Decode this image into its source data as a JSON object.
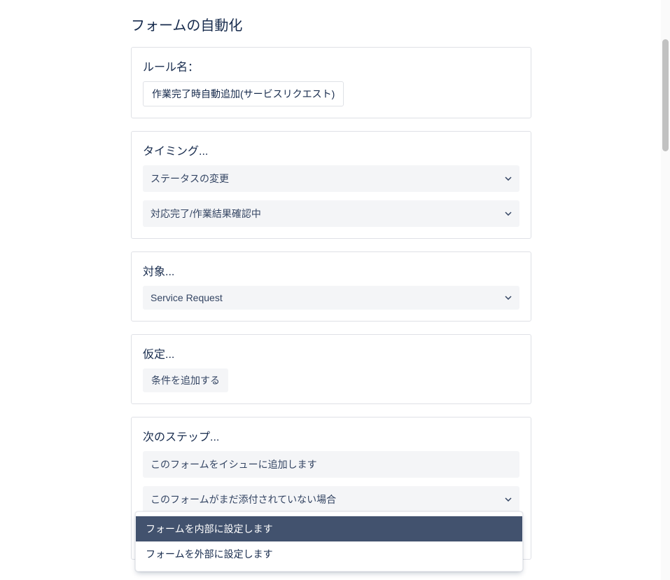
{
  "page": {
    "title": "フォームの自動化"
  },
  "ruleName": {
    "label": "ルール名：",
    "value": "作業完了時自動追加(サービスリクエスト)"
  },
  "timing": {
    "label": "タイミング...",
    "triggerType": "ステータスの変更",
    "statusValue": "対応完了/作業結果確認中"
  },
  "target": {
    "label": "対象...",
    "value": "Service Request"
  },
  "assumption": {
    "label": "仮定...",
    "addConditionLabel": "条件を追加する"
  },
  "nextStep": {
    "label": "次のステップ...",
    "actionLabel": "このフォームをイシューに追加します",
    "conditionValue": "このフォームがまだ添付されていない場合",
    "internalSetValue": "フォームを内部に設定します"
  },
  "dropdown": {
    "options": [
      "フォームを内部に設定します",
      "フォームを外部に設定します"
    ],
    "selectedIndex": 0
  }
}
